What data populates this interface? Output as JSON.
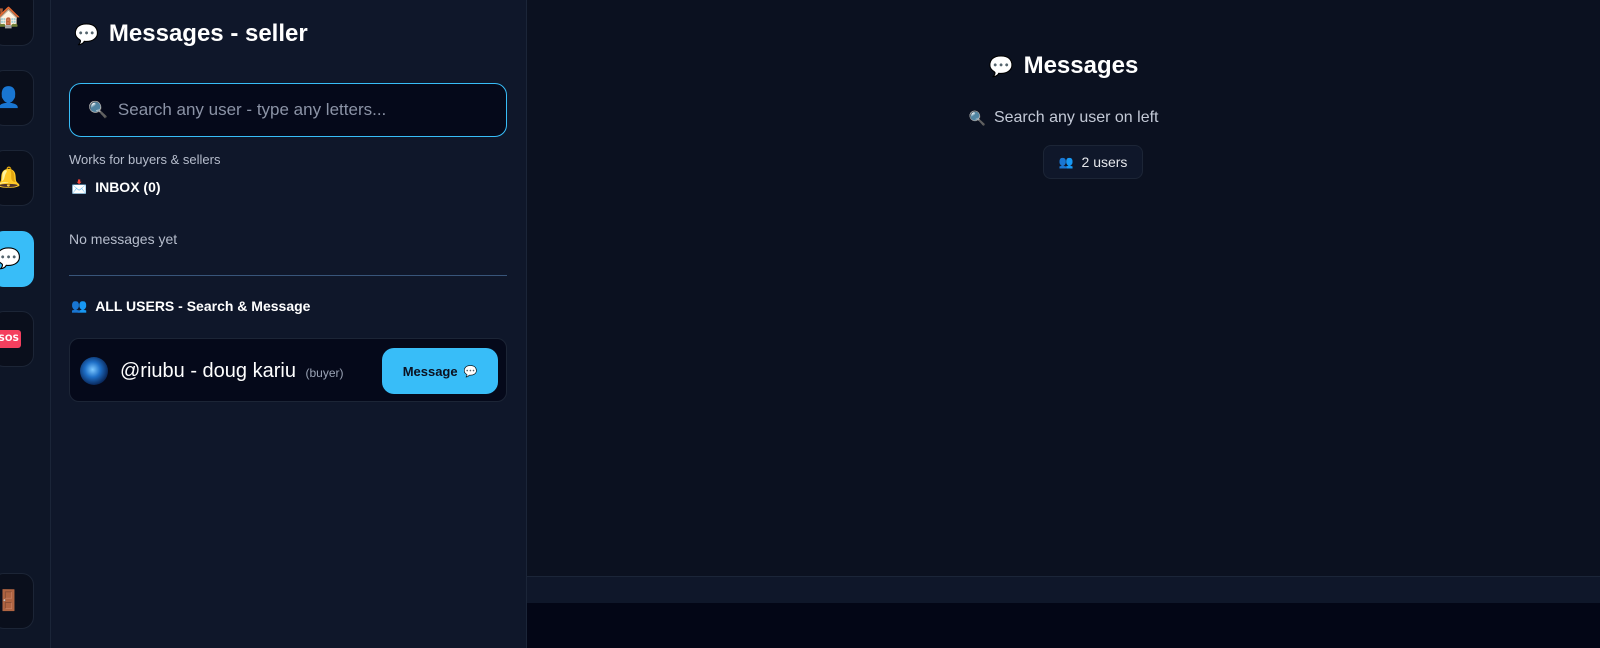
{
  "rail": {
    "items": [
      {
        "name": "home",
        "icon": "🏠"
      },
      {
        "name": "profile",
        "icon": "👤"
      },
      {
        "name": "notifications",
        "icon": "🔔"
      },
      {
        "name": "messages",
        "icon": "💬",
        "active": true
      },
      {
        "name": "sos",
        "label": "SOS"
      },
      {
        "name": "logout",
        "icon": "🚪"
      }
    ]
  },
  "panel": {
    "title_icon": "💬",
    "title": "Messages - seller",
    "search": {
      "icon": "🔍",
      "placeholder": "Search any user - type any letters...",
      "value": ""
    },
    "hint": "Works for buyers & sellers",
    "inbox": {
      "icon": "📩",
      "label": "INBOX (0)",
      "empty_text": "No messages yet"
    },
    "all_users": {
      "icon": "👥",
      "label": "ALL USERS - Search & Message"
    },
    "users": [
      {
        "name": "@riubu - doug kariu",
        "role": "(buyer)",
        "button_label": "Message",
        "button_icon": "💬"
      }
    ]
  },
  "main": {
    "title_icon": "💬",
    "title": "Messages",
    "hint_icon": "🔍",
    "hint": "Search any user on left",
    "count_icon": "👥",
    "count": "2 users"
  },
  "colors": {
    "accent": "#38bdf8",
    "background": "#0b1120",
    "panel": "#0f172a",
    "sos": "#f43f5e"
  }
}
